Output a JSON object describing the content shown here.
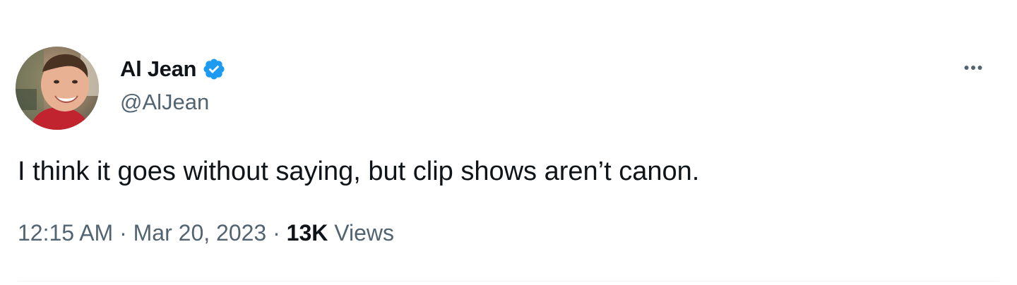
{
  "author": {
    "display_name": "Al Jean",
    "handle": "@AlJean",
    "verified": true,
    "avatar": "profile-photo",
    "verified_badge_color": "#1d9bf0"
  },
  "tweet": {
    "text": "I think it goes without saying, but clip shows aren’t canon.",
    "time": "12:15 AM",
    "separator": " · ",
    "date": "Mar 20, 2023",
    "views_count": "13K",
    "views_label": "Views"
  },
  "icons": {
    "more": "more-horizontal-icon",
    "verified": "verified-badge-icon"
  },
  "colors": {
    "text_primary": "#0f1419",
    "text_secondary": "#536471"
  }
}
